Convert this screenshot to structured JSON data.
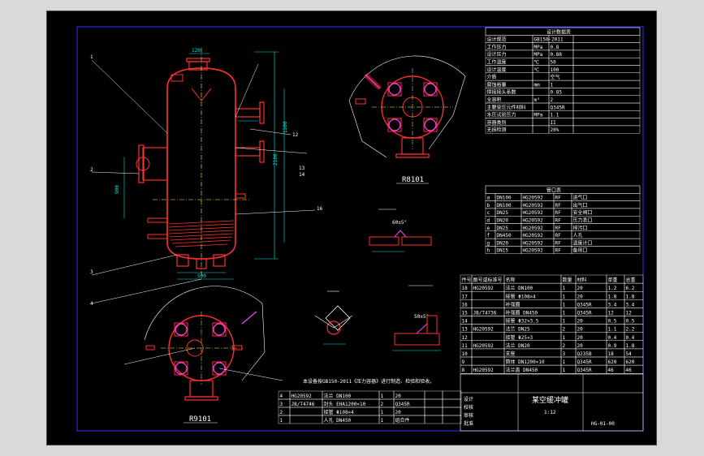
{
  "drawing": {
    "title_cn": "某空缓冲罐",
    "scale_text": "1:12",
    "view_labels": [
      "R8101",
      "R9101"
    ],
    "weld_angle": "60±5°",
    "weld_angle2": "50±5°",
    "tech_note": "本设备按GB150-2011《压力容器》进行制造、检验和验收。",
    "dimension_texts": [
      "120",
      "1500",
      "2100",
      "2400",
      "500",
      "900",
      "100"
    ],
    "part_callouts": [
      "1",
      "2",
      "3",
      "4",
      "5",
      "6",
      "7",
      "8",
      "9",
      "10",
      "11",
      "12",
      "13",
      "14",
      "15",
      "16",
      "17",
      "18"
    ],
    "spec_table_title": "设计数据表",
    "spec_rows": [
      [
        "设计规范",
        "GB150-2011"
      ],
      [
        "工作压力",
        "MPa",
        "0.8"
      ],
      [
        "设计压力",
        "MPa",
        "0.88"
      ],
      [
        "工作温度",
        "℃",
        "50"
      ],
      [
        "设计温度",
        "℃",
        "100"
      ],
      [
        "介质",
        "",
        "空气"
      ],
      [
        "腐蚀裕量",
        "mm",
        "1"
      ],
      [
        "焊接接头系数",
        "",
        "0.85"
      ],
      [
        "全容积",
        "m³",
        "2"
      ],
      [
        "主要受压元件材料",
        "",
        "Q345R"
      ],
      [
        "水压试验压力",
        "MPa",
        "1.1"
      ],
      [
        "容器类别",
        "",
        "II"
      ],
      [
        "无损检测",
        "",
        "20%"
      ]
    ],
    "nozzle_table_title": "管口表",
    "nozzle_rows": [
      [
        "a",
        "DN100",
        "HG20592",
        "RF",
        "进气口"
      ],
      [
        "b",
        "DN100",
        "HG20592",
        "RF",
        "出气口"
      ],
      [
        "c",
        "DN25",
        "HG20592",
        "RF",
        "安全阀口"
      ],
      [
        "d",
        "DN20",
        "HG20592",
        "RF",
        "压力表口"
      ],
      [
        "e",
        "DN25",
        "HG20592",
        "RF",
        "排污口"
      ],
      [
        "f",
        "DN450",
        "HG20592",
        "RF",
        "人孔"
      ],
      [
        "g",
        "DN20",
        "HG20592",
        "RF",
        "温度计口"
      ],
      [
        "h",
        "DN15",
        "HG20592",
        "RF",
        "备用口"
      ]
    ],
    "bom_rows": [
      [
        "18",
        "HG20592",
        "法兰 DN100",
        "1",
        "20",
        "1.2",
        "6.2"
      ],
      [
        "17",
        "",
        "接管 Φ108×4",
        "1",
        "20",
        "1.8",
        "1.8"
      ],
      [
        "16",
        "",
        "补强圈",
        "1",
        "Q345R",
        "3.4",
        "3.4"
      ],
      [
        "15",
        "JB/T4736",
        "补强圈 DN450",
        "1",
        "Q345R",
        "12",
        "12"
      ],
      [
        "14",
        "",
        "接管 Φ32×3.5",
        "1",
        "20",
        "0.5",
        "0.5"
      ],
      [
        "13",
        "HG20592",
        "法兰 DN25",
        "2",
        "20",
        "1.1",
        "2.2"
      ],
      [
        "12",
        "",
        "接管 Φ25×3",
        "1",
        "20",
        "0.4",
        "0.4"
      ],
      [
        "11",
        "HG20592",
        "法兰 DN20",
        "2",
        "20",
        "0.9",
        "1.8"
      ],
      [
        "10",
        "",
        "支座",
        "3",
        "Q235B",
        "18",
        "54"
      ],
      [
        "9",
        "",
        "筒体 DN1200×10",
        "1",
        "Q345R",
        "620",
        "620"
      ],
      [
        "8",
        "HG20592",
        "法兰盖 DN450",
        "1",
        "Q345R",
        "46",
        "46"
      ]
    ],
    "bottom_bom_rows": [
      [
        "4",
        "HG20592",
        "法兰 DN100",
        "1",
        "20",
        "",
        ""
      ],
      [
        "3",
        "JB/T4746",
        "封头 EHA1200×10",
        "2",
        "Q345R",
        "",
        ""
      ],
      [
        "2",
        "",
        "接管 Φ108×4",
        "1",
        "20",
        "",
        ""
      ],
      [
        "1",
        "",
        "人孔 DN450",
        "1",
        "组合件",
        "",
        ""
      ]
    ],
    "bom_header": [
      "件号",
      "图号或标准号",
      "名称",
      "数量",
      "材料",
      "单重",
      "总重"
    ],
    "title_block_rows": [
      "设计",
      "校核",
      "审核",
      "批准"
    ],
    "drawing_no": "HG-01-00"
  },
  "colors": {
    "background": "#000000",
    "vessel": "#ff3030",
    "dimension": "#00e5e5",
    "leader": "#ffffff",
    "border": "#3030ff",
    "magenta": "#ff40ff",
    "green": "#40ff40",
    "yellow": "#ffff40"
  }
}
